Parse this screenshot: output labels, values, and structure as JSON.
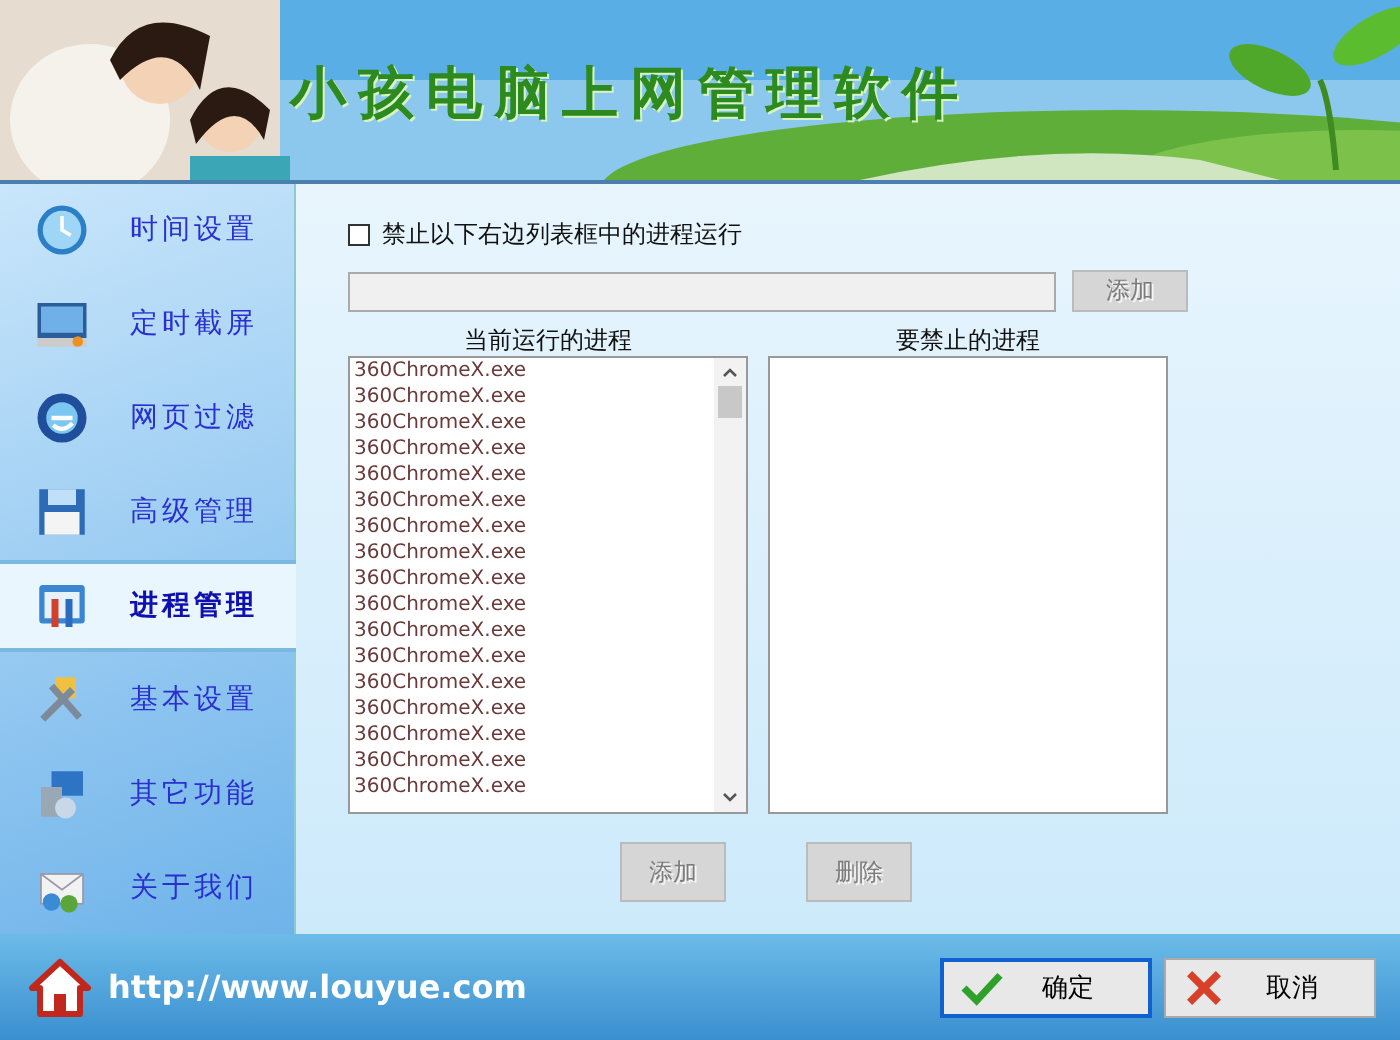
{
  "header": {
    "title": "小孩电脑上网管理软件"
  },
  "sidebar": {
    "items": [
      {
        "label": "时间设置",
        "selected": false
      },
      {
        "label": "定时截屏",
        "selected": false
      },
      {
        "label": "网页过滤",
        "selected": false
      },
      {
        "label": "高级管理",
        "selected": false
      },
      {
        "label": "进程管理",
        "selected": true
      },
      {
        "label": "基本设置",
        "selected": false
      },
      {
        "label": "其它功能",
        "selected": false
      },
      {
        "label": "关于我们",
        "selected": false
      }
    ]
  },
  "ban_option": {
    "label": "禁止以下右边列表框中的进程运行",
    "checked": false
  },
  "process_field": {
    "add_button": {
      "label": "添加",
      "disabled": true
    }
  },
  "running_list": {
    "heading": "当前运行的进程",
    "rows": [
      "360ChromeX.exe",
      "360ChromeX.exe",
      "360ChromeX.exe",
      "360ChromeX.exe",
      "360ChromeX.exe",
      "360ChromeX.exe",
      "360ChromeX.exe",
      "360ChromeX.exe",
      "360ChromeX.exe",
      "360ChromeX.exe",
      "360ChromeX.exe",
      "360ChromeX.exe",
      "360ChromeX.exe",
      "360ChromeX.exe",
      "360ChromeX.exe",
      "360ChromeX.exe",
      "360ChromeX.exe"
    ]
  },
  "blocked_list": {
    "heading": "要禁止的进程"
  },
  "list_buttons": [
    {
      "label": "添加",
      "disabled": true
    },
    {
      "label": "删除",
      "disabled": true
    }
  ],
  "footer": {
    "url": "http://www.louyue.com",
    "buttons": [
      {
        "label": "确定",
        "kind": "ok"
      },
      {
        "label": "取消",
        "kind": "cancel"
      }
    ]
  }
}
